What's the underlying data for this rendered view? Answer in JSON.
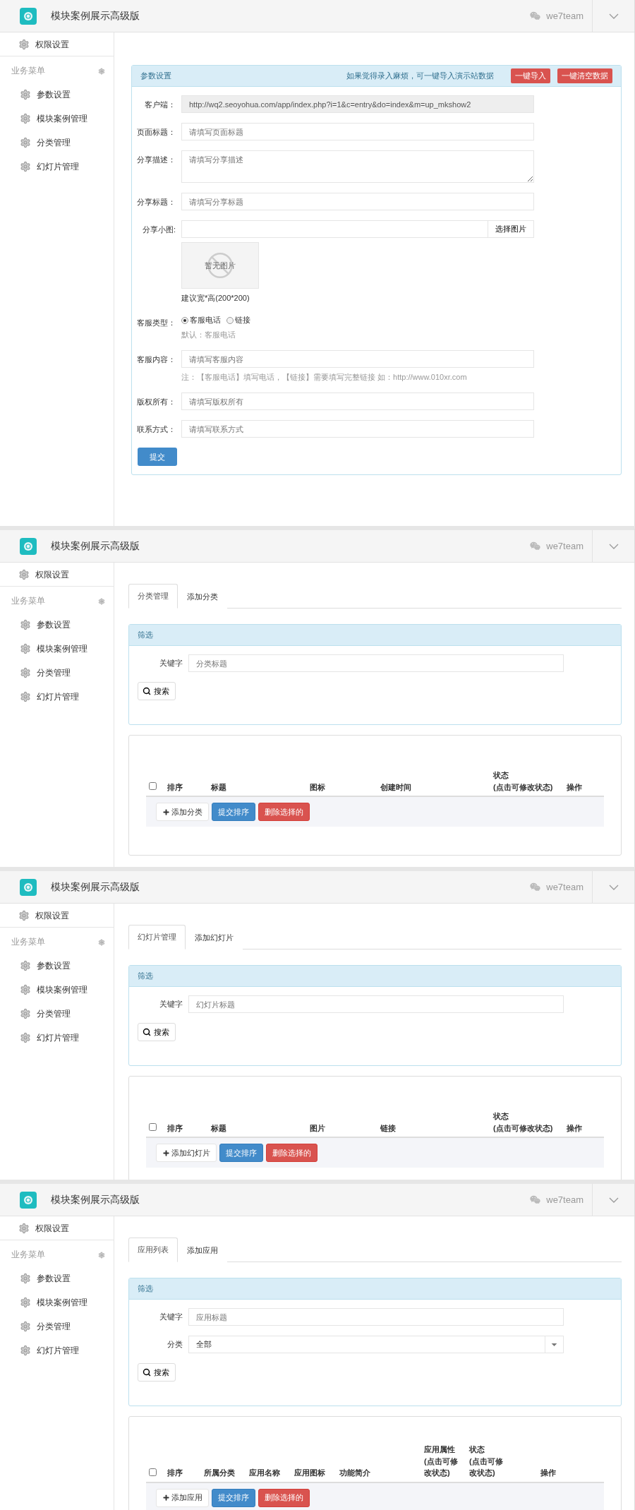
{
  "screens": [
    {
      "kind": "form",
      "header": {
        "title": "模块案例展示高级版",
        "user": "we7team"
      },
      "sidebar": {
        "top_item": "权限设置",
        "section_label": "业务菜单",
        "items": [
          "参数设置",
          "模块案例管理",
          "分类管理",
          "幻灯片管理"
        ]
      },
      "panel": {
        "title": "参数设置",
        "hint": "如果觉得录入麻烦，可一键导入演示站数据",
        "buttons": [
          "一键导入",
          "一键清空数据"
        ]
      },
      "fields": [
        {
          "kind": "readonly",
          "label": "客户端：",
          "value": "http://wq2.seoyohua.com/app/index.php?i=1&c=entry&do=index&m=up_mkshow2"
        },
        {
          "kind": "text",
          "label": "页面标题：",
          "placeholder": "请填写页面标题"
        },
        {
          "kind": "textarea",
          "label": "分享描述：",
          "placeholder": "请填写分享描述"
        },
        {
          "kind": "text",
          "label": "分享标题：",
          "placeholder": "请填写分享标题"
        },
        {
          "kind": "image",
          "label": "分享小图:",
          "button": "选择图片",
          "empty_text": "暂无图片",
          "help": "建议宽*高(200*200)"
        },
        {
          "kind": "radio",
          "label": "客服类型：",
          "options": [
            {
              "label": "客服电话",
              "selected": true
            },
            {
              "label": "链接",
              "selected": false
            }
          ],
          "help": "默认：客服电话"
        },
        {
          "kind": "text",
          "label": "客服内容：",
          "placeholder": "请填写客服内容",
          "help": "注：【客服电话】填写电话，【链接】需要填写完整链接 如：http://www.010xr.com"
        },
        {
          "kind": "text",
          "label": "版权所有：",
          "placeholder": "请填写版权所有"
        },
        {
          "kind": "text",
          "label": "联系方式：",
          "placeholder": "请填写联系方式"
        }
      ],
      "submit": "提交"
    },
    {
      "kind": "list",
      "header": {
        "title": "模块案例展示高级版",
        "user": "we7team"
      },
      "sidebar": {
        "top_item": "权限设置",
        "section_label": "业务菜单",
        "items": [
          "参数设置",
          "模块案例管理",
          "分类管理",
          "幻灯片管理"
        ]
      },
      "tabs": [
        {
          "label": "分类管理",
          "selected": true
        },
        {
          "label": "添加分类",
          "selected": false
        }
      ],
      "filter": {
        "title": "筛选",
        "filters": [
          {
            "kind": "text",
            "label": "关键字",
            "placeholder": "分类标题"
          }
        ],
        "search": "搜索"
      },
      "table": {
        "select_all": {
          "checked": false
        },
        "columns": [
          [
            "排序"
          ],
          [
            "标题"
          ],
          [
            "图标"
          ],
          [
            "创建时间"
          ],
          [
            "状态",
            "(点击可修改状态)"
          ],
          [
            "操作"
          ]
        ],
        "actions": [
          {
            "kind": "default",
            "label": "添加分类"
          },
          {
            "kind": "primary",
            "label": "提交排序"
          },
          {
            "kind": "danger",
            "label": "删除选择的"
          }
        ]
      }
    },
    {
      "kind": "list",
      "header": {
        "title": "模块案例展示高级版",
        "user": "we7team"
      },
      "sidebar": {
        "top_item": "权限设置",
        "section_label": "业务菜单",
        "items": [
          "参数设置",
          "模块案例管理",
          "分类管理",
          "幻灯片管理"
        ]
      },
      "tabs": [
        {
          "label": "幻灯片管理",
          "selected": true
        },
        {
          "label": "添加幻灯片",
          "selected": false
        }
      ],
      "filter": {
        "title": "筛选",
        "filters": [
          {
            "kind": "text",
            "label": "关键字",
            "placeholder": "幻灯片标题"
          }
        ],
        "search": "搜索"
      },
      "table": {
        "select_all": {
          "checked": false
        },
        "columns": [
          [
            "排序"
          ],
          [
            "标题"
          ],
          [
            "图片"
          ],
          [
            "链接"
          ],
          [
            "状态",
            "(点击可修改状态)"
          ],
          [
            "操作"
          ]
        ],
        "actions": [
          {
            "kind": "default",
            "label": "添加幻灯片"
          },
          {
            "kind": "primary",
            "label": "提交排序"
          },
          {
            "kind": "danger",
            "label": "删除选择的"
          }
        ]
      }
    },
    {
      "kind": "list",
      "header": {
        "title": "模块案例展示高级版",
        "user": "we7team"
      },
      "sidebar": {
        "top_item": "权限设置",
        "section_label": "业务菜单",
        "items": [
          "参数设置",
          "模块案例管理",
          "分类管理",
          "幻灯片管理"
        ]
      },
      "tabs": [
        {
          "label": "应用列表",
          "selected": true
        },
        {
          "label": "添加应用",
          "selected": false
        }
      ],
      "filter": {
        "title": "筛选",
        "filters": [
          {
            "kind": "text",
            "label": "关键字",
            "placeholder": "应用标题"
          },
          {
            "kind": "select",
            "label": "分类",
            "value": "全部"
          }
        ],
        "search": "搜索"
      },
      "table": {
        "select_all": {
          "checked": false
        },
        "columns": [
          [
            "排序"
          ],
          [
            "所属分类"
          ],
          [
            "应用名称"
          ],
          [
            "应用图标"
          ],
          [
            "功能简介"
          ],
          [
            "应用属性",
            "(点击可修",
            "改状态)"
          ],
          [
            "状态",
            "(点击可修",
            "改状态)"
          ],
          [
            "操作"
          ]
        ],
        "actions": [
          {
            "kind": "default",
            "label": "添加应用"
          },
          {
            "kind": "primary",
            "label": "提交排序"
          },
          {
            "kind": "danger",
            "label": "删除选择的"
          }
        ]
      }
    }
  ]
}
